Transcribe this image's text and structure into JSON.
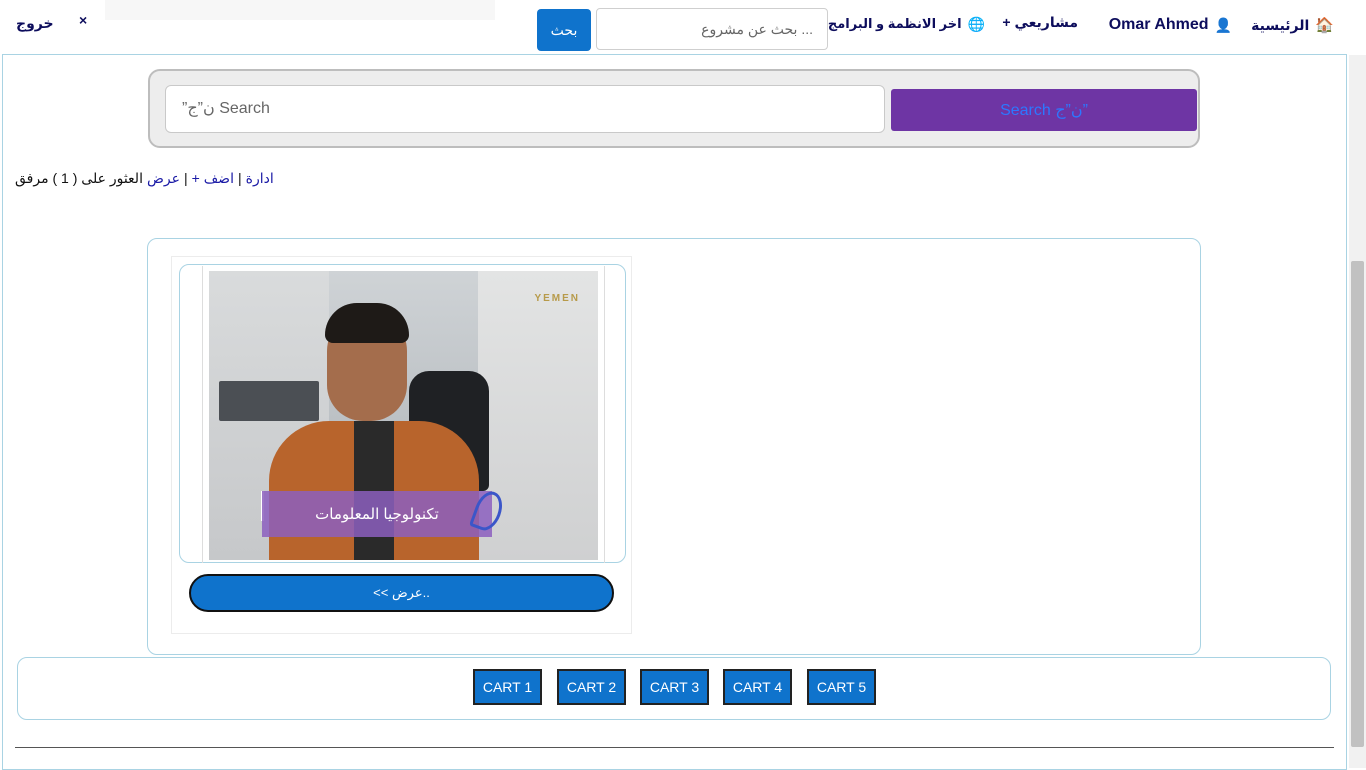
{
  "nav": {
    "home_label": "الرئيسية",
    "user_name": "Omar Ahmed",
    "projects_label": "مشاريعي +",
    "latest_label": "اخر الانظمة و البرامج",
    "search_placeholder": "... بحث عن مشروع",
    "search_button": "بحث",
    "close_glyph": "×",
    "logout_label": "خروج"
  },
  "search": {
    "placeholder": "Search ن”ج”",
    "button_label": "Search ن”ج”"
  },
  "info": {
    "manage_link": "ادارة",
    "add_link": "اضف +",
    "view_link": "عرض",
    "found_text": "العثور على ( 1 ) مرفق"
  },
  "card": {
    "caption": "تكنولوجيا المعلومات",
    "watermark": "YEMEN",
    "view_button": "<< عرض.."
  },
  "pagination": [
    "CART 1",
    "CART 2",
    "CART 3",
    "CART 4",
    "CART 5"
  ],
  "colors": {
    "primary": "#0f73cc",
    "search_button": "#6e35a4",
    "nav_text": "#0d0d5c",
    "link": "#1a1aa6",
    "border": "#a9d3e3"
  }
}
